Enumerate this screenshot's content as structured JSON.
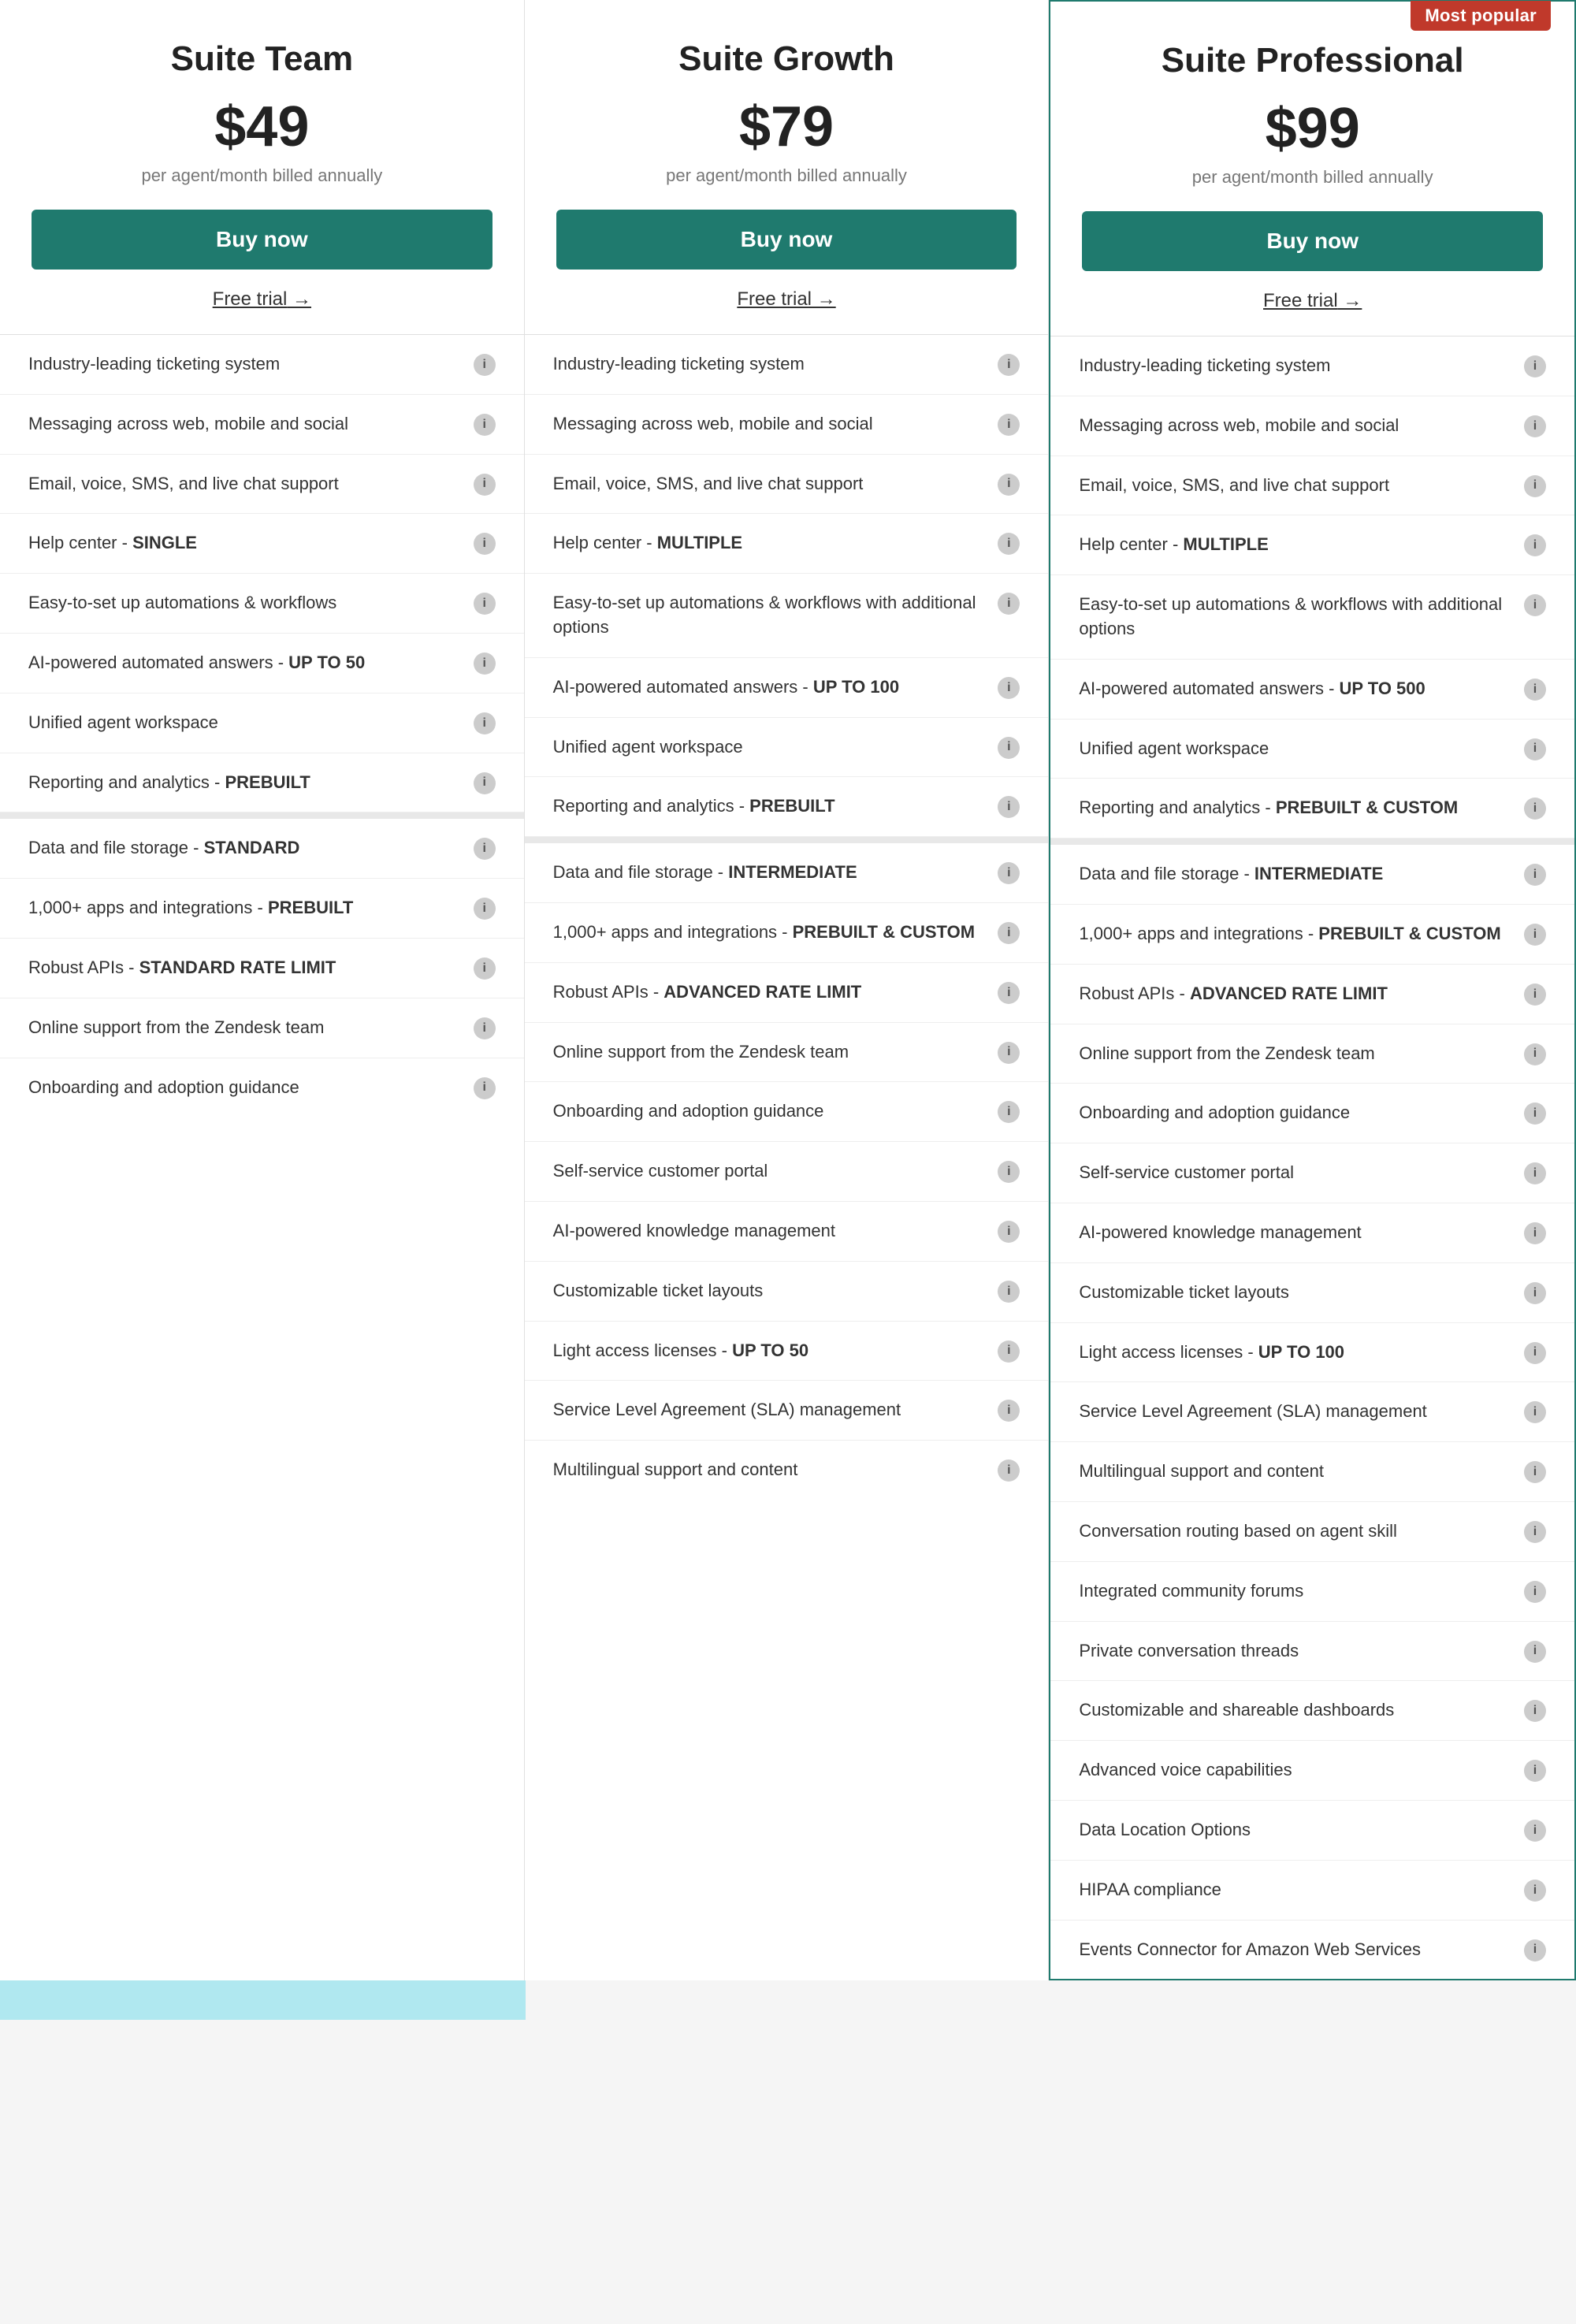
{
  "plans": [
    {
      "id": "suite-team",
      "name": "Suite Team",
      "price": "$49",
      "billing": "per agent/month billed annually",
      "buy_label": "Buy now",
      "free_trial_label": "Free trial",
      "featured": false,
      "most_popular": false,
      "features": [
        {
          "text": "Industry-leading ticketing system",
          "bold": ""
        },
        {
          "text": "Messaging across web, mobile and social",
          "bold": ""
        },
        {
          "text": "Email, voice, SMS, and live chat support",
          "bold": ""
        },
        {
          "text": "Help center - ",
          "bold": "SINGLE"
        },
        {
          "text": "Easy-to-set up automations & workflows",
          "bold": ""
        },
        {
          "text": "AI-powered automated answers - ",
          "bold": "UP TO 50"
        },
        {
          "text": "Unified agent workspace",
          "bold": ""
        },
        {
          "text": "Reporting and analytics - ",
          "bold": "PREBUILT"
        },
        {
          "divider": true
        },
        {
          "text": "Data and file storage - ",
          "bold": "STANDARD"
        },
        {
          "text": "1,000+ apps and integrations - ",
          "bold": "PREBUILT"
        },
        {
          "text": "Robust APIs - ",
          "bold": "STANDARD RATE LIMIT"
        },
        {
          "text": "Online support from the Zendesk team",
          "bold": ""
        },
        {
          "text": "Onboarding and adoption guidance",
          "bold": ""
        }
      ]
    },
    {
      "id": "suite-growth",
      "name": "Suite Growth",
      "price": "$79",
      "billing": "per agent/month billed annually",
      "buy_label": "Buy now",
      "free_trial_label": "Free trial",
      "featured": false,
      "most_popular": false,
      "features": [
        {
          "text": "Industry-leading ticketing system",
          "bold": ""
        },
        {
          "text": "Messaging across web, mobile and social",
          "bold": ""
        },
        {
          "text": "Email, voice, SMS, and live chat support",
          "bold": ""
        },
        {
          "text": "Help center - ",
          "bold": "MULTIPLE"
        },
        {
          "text": "Easy-to-set up automations & workflows with additional options",
          "bold": ""
        },
        {
          "text": "AI-powered automated answers - ",
          "bold": "UP TO 100"
        },
        {
          "text": "Unified agent workspace",
          "bold": ""
        },
        {
          "text": "Reporting and analytics - ",
          "bold": "PREBUILT"
        },
        {
          "divider": true
        },
        {
          "text": "Data and file storage - ",
          "bold": "INTERMEDIATE"
        },
        {
          "text": "1,000+ apps and integrations - ",
          "bold": "PREBUILT & CUSTOM"
        },
        {
          "text": "Robust APIs - ",
          "bold": "ADVANCED RATE LIMIT"
        },
        {
          "text": "Online support from the Zendesk team",
          "bold": ""
        },
        {
          "text": "Onboarding and adoption guidance",
          "bold": ""
        },
        {
          "text": "Self-service customer portal",
          "bold": ""
        },
        {
          "text": "AI-powered knowledge management",
          "bold": ""
        },
        {
          "text": "Customizable ticket layouts",
          "bold": ""
        },
        {
          "text": "Light access licenses - ",
          "bold": "UP TO 50"
        },
        {
          "text": "Service Level Agreement (SLA) management",
          "bold": ""
        },
        {
          "text": "Multilingual support and content",
          "bold": ""
        }
      ]
    },
    {
      "id": "suite-professional",
      "name": "Suite Professional",
      "price": "$99",
      "billing": "per agent/month billed annually",
      "buy_label": "Buy now",
      "free_trial_label": "Free trial",
      "featured": true,
      "most_popular": true,
      "most_popular_label": "Most popular",
      "features": [
        {
          "text": "Industry-leading ticketing system",
          "bold": ""
        },
        {
          "text": "Messaging across web, mobile and social",
          "bold": ""
        },
        {
          "text": "Email, voice, SMS, and live chat support",
          "bold": ""
        },
        {
          "text": "Help center - ",
          "bold": "MULTIPLE"
        },
        {
          "text": "Easy-to-set up automations & workflows with additional options",
          "bold": ""
        },
        {
          "text": "AI-powered automated answers - ",
          "bold": "UP TO 500"
        },
        {
          "text": "Unified agent workspace",
          "bold": ""
        },
        {
          "text": "Reporting and analytics - ",
          "bold": "PREBUILT & CUSTOM"
        },
        {
          "divider": true
        },
        {
          "text": "Data and file storage - ",
          "bold": "INTERMEDIATE"
        },
        {
          "text": "1,000+ apps and integrations - ",
          "bold": "PREBUILT & CUSTOM"
        },
        {
          "text": "Robust APIs - ",
          "bold": "ADVANCED RATE LIMIT"
        },
        {
          "text": "Online support from the Zendesk team",
          "bold": ""
        },
        {
          "text": "Onboarding and adoption guidance",
          "bold": ""
        },
        {
          "text": "Self-service customer portal",
          "bold": ""
        },
        {
          "text": "AI-powered knowledge management",
          "bold": ""
        },
        {
          "text": "Customizable ticket layouts",
          "bold": ""
        },
        {
          "text": "Light access licenses - ",
          "bold": "UP TO 100"
        },
        {
          "text": "Service Level Agreement (SLA) management",
          "bold": ""
        },
        {
          "text": "Multilingual support and content",
          "bold": ""
        },
        {
          "text": "Conversation routing based on agent skill",
          "bold": ""
        },
        {
          "text": "Integrated community forums",
          "bold": ""
        },
        {
          "text": "Private conversation threads",
          "bold": ""
        },
        {
          "text": "Customizable and shareable dashboards",
          "bold": ""
        },
        {
          "text": "Advanced voice capabilities",
          "bold": ""
        },
        {
          "text": "Data Location Options",
          "bold": ""
        },
        {
          "text": "HIPAA compliance",
          "bold": ""
        },
        {
          "text": "Events Connector for Amazon Web Services",
          "bold": ""
        }
      ]
    }
  ]
}
